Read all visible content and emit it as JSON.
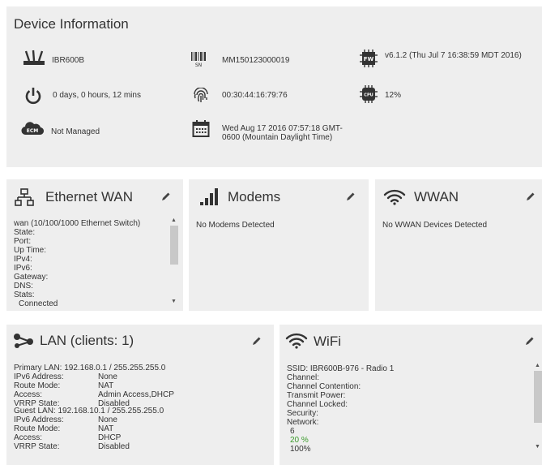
{
  "device": {
    "title": "Device Information",
    "model": "IBR600B",
    "serial": "MM150123000019",
    "firmware": "v6.1.2 (Thu Jul 7 16:38:59 MDT 2016)",
    "uptime": "0 days, 0 hours, 12 mins",
    "mac": "00:30:44:16:79:76",
    "cpu": "12%",
    "ecm_status": "Not Managed",
    "datetime": "Wed Aug 17 2016 07:57:18 GMT-0600 (Mountain Daylight Time)",
    "icon_labels": {
      "sn": "SN",
      "fw": "FW",
      "cpu": "CPU",
      "ecm": "ECM"
    }
  },
  "ethernet_wan": {
    "title": "Ethernet WAN",
    "lines": [
      "wan (10/100/1000 Ethernet Switch)",
      "State:",
      "Port:",
      "Up Time:",
      "IPv4:",
      "IPv6:",
      "Gateway:",
      "DNS:",
      "Stats:",
      "Connected"
    ]
  },
  "modems": {
    "title": "Modems",
    "message": "No Modems Detected"
  },
  "wwan": {
    "title": "WWAN",
    "message": "No WWAN Devices Detected"
  },
  "lan": {
    "title": "LAN (clients: 1)",
    "primary_label": "Primary LAN: 192.168.0.1 / 255.255.255.0",
    "primary": [
      {
        "k": "IPv6 Address:",
        "v": "None"
      },
      {
        "k": "Route Mode:",
        "v": "NAT"
      },
      {
        "k": "Access:",
        "v": "Admin Access,DHCP"
      },
      {
        "k": "VRRP State:",
        "v": "Disabled"
      }
    ],
    "guest_label": "Guest LAN: 192.168.10.1 / 255.255.255.0",
    "guest": [
      {
        "k": "IPv6 Address:",
        "v": "None"
      },
      {
        "k": "Route Mode:",
        "v": "NAT"
      },
      {
        "k": "Access:",
        "v": "DHCP"
      },
      {
        "k": "VRRP State:",
        "v": "Disabled"
      }
    ]
  },
  "wifi": {
    "title": "WiFi",
    "lines": [
      "SSID: IBR600B-976 - Radio 1",
      "Channel:",
      "Channel Contention:",
      "Transmit Power:",
      "Channel Locked:",
      "Security:",
      "Network:",
      "6"
    ],
    "percent": "20 %",
    "cut_line": "100%"
  },
  "colors": {
    "panel_bg": "#eeeeee",
    "icon": "#333333",
    "green": "#3a9a2a"
  }
}
